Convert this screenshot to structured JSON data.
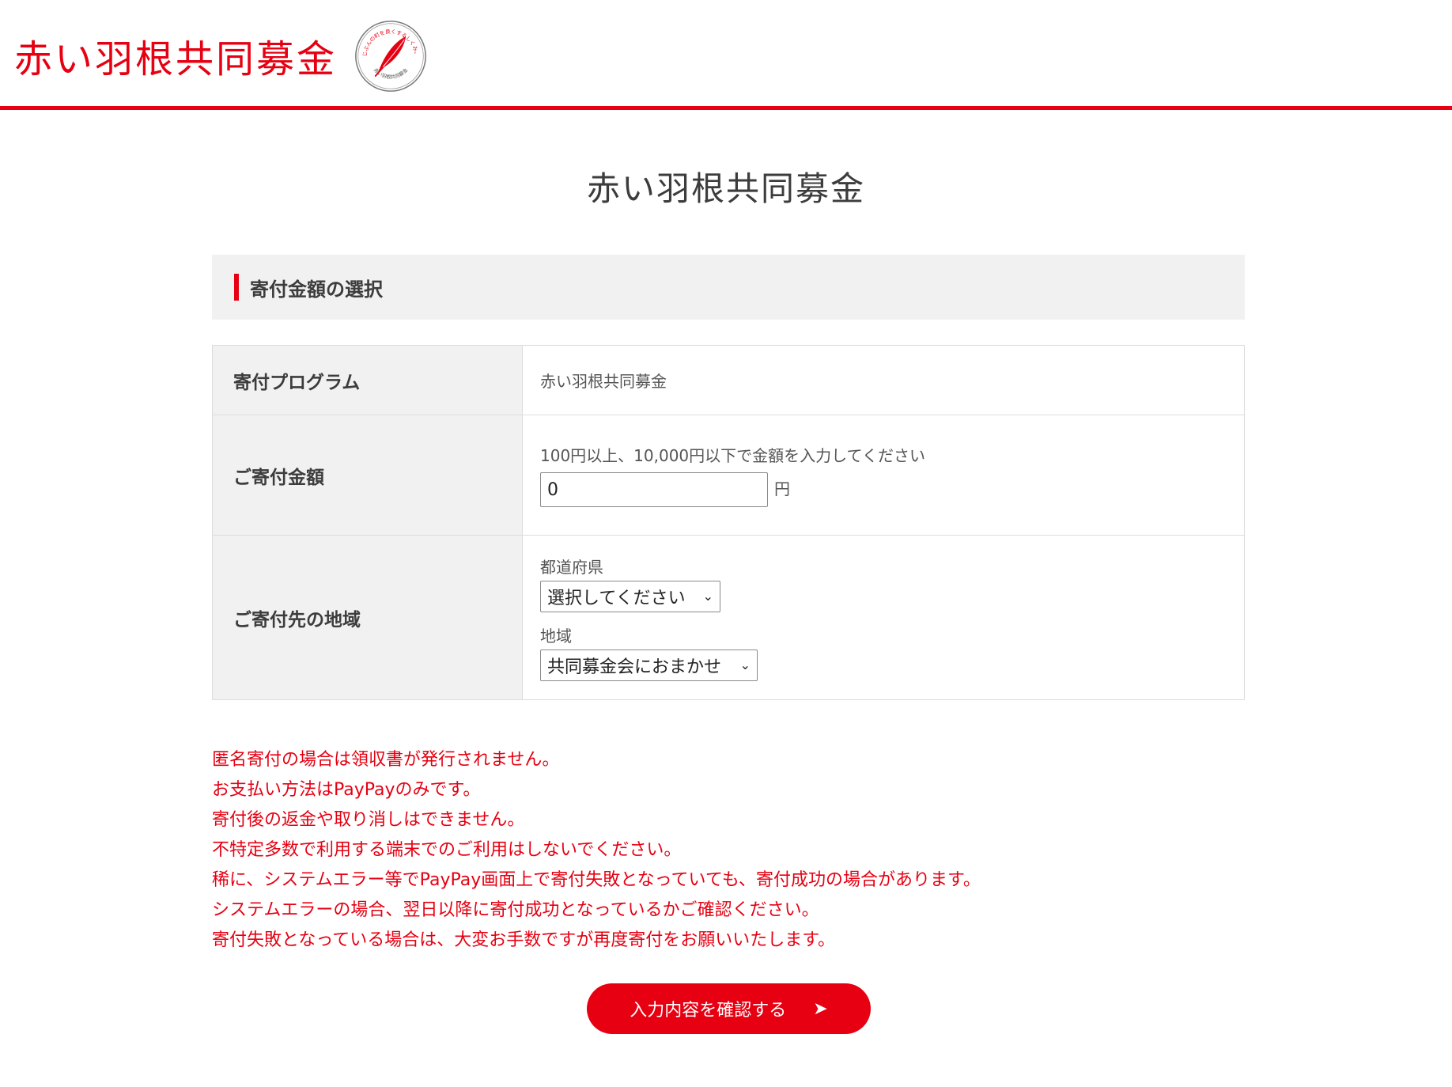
{
  "header": {
    "brand_text": "赤い羽根共同募金",
    "seal_top_text": "じぶんの町を良くするしくみ。",
    "seal_bottom_text": "赤い羽根共同募金"
  },
  "page_title": "赤い羽根共同募金",
  "section": {
    "heading": "寄付金額の選択"
  },
  "form": {
    "program": {
      "label": "寄付プログラム",
      "value": "赤い羽根共同募金"
    },
    "amount": {
      "label": "ご寄付金額",
      "hint": "100円以上、10,000円以下で金額を入力してください",
      "value": "0",
      "unit": "円"
    },
    "region": {
      "label": "ご寄付先の地域",
      "prefecture_label": "都道府県",
      "prefecture_value": "選択してください",
      "area_label": "地域",
      "area_value": "共同募金会におまかせ"
    }
  },
  "notices": [
    "匿名寄付の場合は領収書が発行されません。",
    "お支払い方法はPayPayのみです。",
    "寄付後の返金や取り消しはできません。",
    "不特定多数で利用する端末でのご利用はしないでください。",
    "稀に、システムエラー等でPayPay画面上で寄付失敗となっていても、寄付成功の場合があります。",
    "システムエラーの場合、翌日以降に寄付成功となっているかご確認ください。",
    "寄付失敗となっている場合は、大変お手数ですが再度寄付をお願いいたします。"
  ],
  "submit": {
    "label": "入力内容を確認する",
    "arrow": "➤"
  },
  "icons": {
    "feather": "red-feather-icon",
    "chevron": "chevron-down-icon"
  },
  "colors": {
    "brand_red": "#e60012",
    "panel_gray": "#f1f1f1",
    "border_gray": "#dcdcdc"
  }
}
